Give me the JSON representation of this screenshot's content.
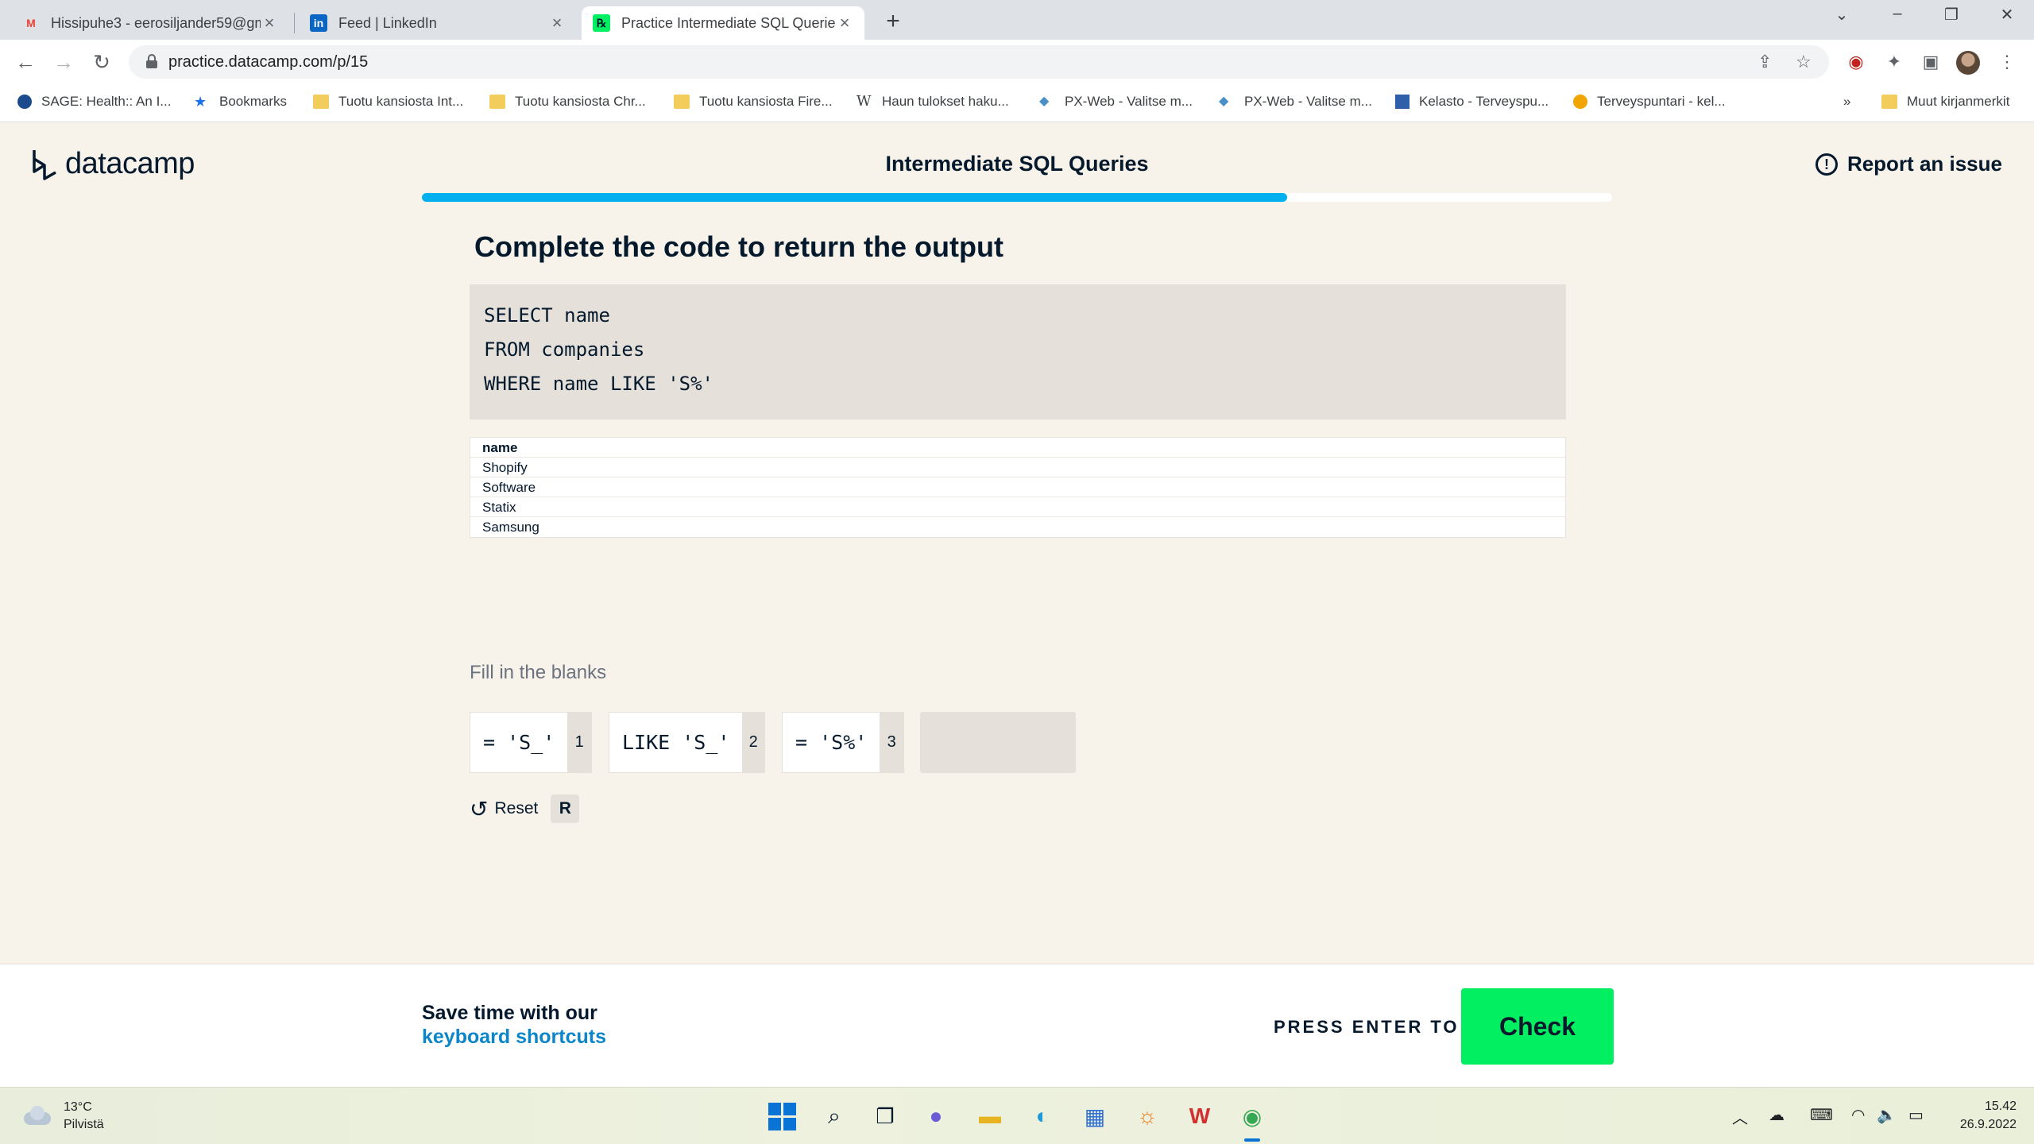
{
  "browser": {
    "tabs": [
      {
        "title": "Hissipuhe3 - eerosiljander59@gm",
        "favicon": "gmail-icon"
      },
      {
        "title": "Feed | LinkedIn",
        "favicon": "linkedin-icon"
      },
      {
        "title": "Practice Intermediate SQL Querie",
        "favicon": "datacamp-icon",
        "active": true
      }
    ],
    "url": "practice.datacamp.com/p/15",
    "bookmarks": [
      {
        "label": "SAGE: Health:: An I...",
        "icon": "sage-icon"
      },
      {
        "label": "Bookmarks",
        "icon": "star-icon"
      },
      {
        "label": "Tuotu kansiosta Int...",
        "icon": "folder-icon"
      },
      {
        "label": "Tuotu kansiosta Chr...",
        "icon": "folder-icon"
      },
      {
        "label": "Tuotu kansiosta Fire...",
        "icon": "folder-icon"
      },
      {
        "label": "Haun tulokset haku...",
        "icon": "wikipedia-icon"
      },
      {
        "label": "PX-Web - Valitse m...",
        "icon": "px-web-icon"
      },
      {
        "label": "PX-Web - Valitse m...",
        "icon": "px-web-icon"
      },
      {
        "label": "Kelasto - Terveyspu...",
        "icon": "kelasto-icon"
      },
      {
        "label": "Terveyspuntari - kel...",
        "icon": "terveyspuntari-icon"
      }
    ],
    "bookmarks_overflow": "»",
    "other_bookmarks": "Muut kirjanmerkit"
  },
  "header": {
    "logo_text": "datacamp",
    "lesson_title": "Intermediate SQL Queries",
    "report_label": "Report an issue",
    "progress": 0.727
  },
  "exercise": {
    "heading": "Complete the code to return the output",
    "code_lines": [
      "SELECT name",
      "FROM companies",
      "WHERE name LIKE 'S%'"
    ],
    "result": {
      "column": "name",
      "rows": [
        "Shopify",
        "Software",
        "Statix",
        "Samsung"
      ]
    },
    "fill_label": "Fill in the blanks",
    "options": [
      {
        "text": "= 'S_'",
        "key": "1"
      },
      {
        "text": "LIKE 'S_'",
        "key": "2"
      },
      {
        "text": "= 'S%'",
        "key": "3"
      }
    ],
    "reset_label": "Reset",
    "reset_key": "R"
  },
  "footer": {
    "line1": "Save time with our",
    "line2": "keyboard shortcuts",
    "press_label": "PRESS ENTER TO",
    "check_label": "Check"
  },
  "taskbar": {
    "temperature": "13°C",
    "weather": "Pilvistä",
    "time": "15.42",
    "date": "26.9.2022"
  },
  "colors": {
    "progress": "#03b0ef",
    "check_button": "#03ef62",
    "link": "#0c85c9",
    "page_bg": "#f7f3eb"
  }
}
